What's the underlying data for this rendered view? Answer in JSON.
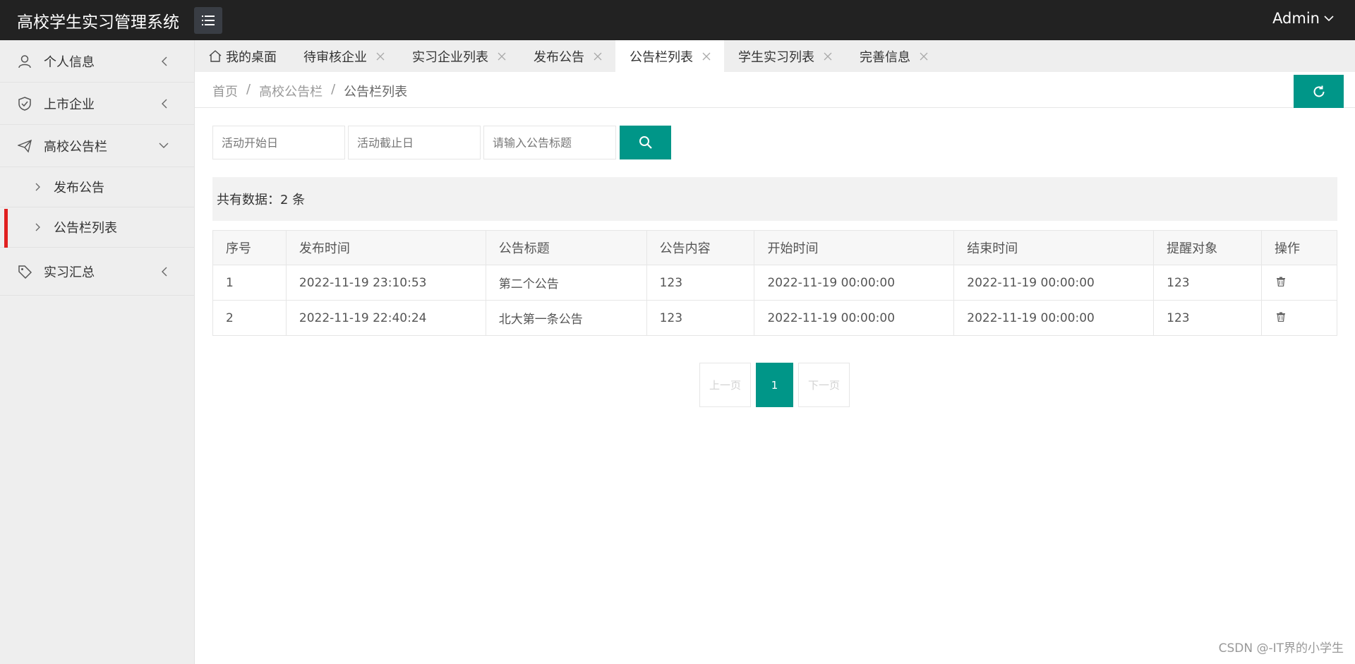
{
  "header": {
    "title": "高校学生实习管理系统",
    "user": "Admin"
  },
  "sidebar": {
    "items": [
      {
        "label": "个人信息"
      },
      {
        "label": "上市企业"
      },
      {
        "label": "高校公告栏"
      },
      {
        "label": "实习汇总"
      }
    ],
    "subitems": [
      {
        "label": "发布公告"
      },
      {
        "label": "公告栏列表"
      }
    ]
  },
  "tabs": [
    {
      "label": "我的桌面"
    },
    {
      "label": "待审核企业"
    },
    {
      "label": "实习企业列表"
    },
    {
      "label": "发布公告"
    },
    {
      "label": "公告栏列表"
    },
    {
      "label": "学生实习列表"
    },
    {
      "label": "完善信息"
    }
  ],
  "breadcrumb": {
    "home": "首页",
    "section": "高校公告栏",
    "current": "公告栏列表",
    "sep": "/"
  },
  "search": {
    "start_placeholder": "活动开始日",
    "end_placeholder": "活动截止日",
    "title_placeholder": "请输入公告标题"
  },
  "summary": {
    "text": "共有数据：2 条"
  },
  "table": {
    "columns": [
      "序号",
      "发布时间",
      "公告标题",
      "公告内容",
      "开始时间",
      "结束时间",
      "提醒对象",
      "操作"
    ],
    "rows": [
      [
        "1",
        "2022-11-19 23:10:53",
        "第二个公告",
        "123",
        "2022-11-19 00:00:00",
        "2022-11-19 00:00:00",
        "123"
      ],
      [
        "2",
        "2022-11-19 22:40:24",
        "北大第一条公告",
        "123",
        "2022-11-19 00:00:00",
        "2022-11-19 00:00:00",
        "123"
      ]
    ]
  },
  "pagination": {
    "prev": "上一页",
    "current": "1",
    "next": "下一页"
  },
  "watermark": "CSDN @-IT界的小学生",
  "colors": {
    "header": "#222222",
    "accent": "#009688",
    "active_marker": "#e02020",
    "sidebar": "#eeeeee"
  },
  "icons": [
    "menu-icon",
    "chevron-down-icon",
    "user-icon",
    "shield-icon",
    "send-icon",
    "tag-icon",
    "chevron-left-icon",
    "chevron-right-icon",
    "home-icon",
    "close-icon",
    "refresh-icon",
    "search-icon",
    "trash-icon"
  ]
}
